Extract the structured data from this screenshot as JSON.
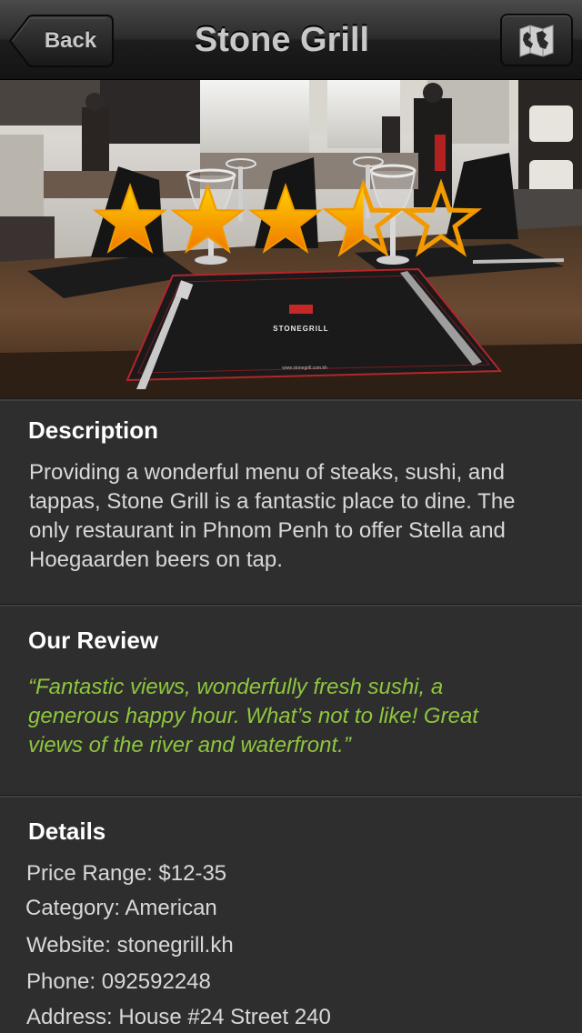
{
  "nav": {
    "back_label": "Back",
    "title": "Stone Grill",
    "map_icon": "map-icon"
  },
  "hero": {
    "placemat_brand": "STONEGRILL",
    "placemat_url": "www.stonegrill.com.kh"
  },
  "rating": {
    "value": 3.5,
    "max": 5,
    "star_color_top": "#ffd200",
    "star_color_bottom": "#f07800"
  },
  "description": {
    "heading": "Description",
    "lines": [
      "Providing a wonderful menu of steaks, sushi, and",
      "tappas, Stone Grill is a fantastic place to dine. The",
      "only restaurant in Phnom Penh to offer Stella and",
      "Hoegaarden beers on tap."
    ]
  },
  "review": {
    "heading": "Our Review",
    "lines": [
      "“Fantastic views, wonderfully fresh sushi, a",
      "generous happy hour. What’s not to like! Great",
      "views of the river and waterfront.”"
    ],
    "color": "#8ec63f"
  },
  "details": {
    "heading": "Details",
    "price_range": "Price Range: $12-35",
    "category": "Category: American",
    "website": "Website: stonegrill.kh",
    "phone": "Phone: 092592248",
    "address": "Address: House #24 Street 240"
  }
}
